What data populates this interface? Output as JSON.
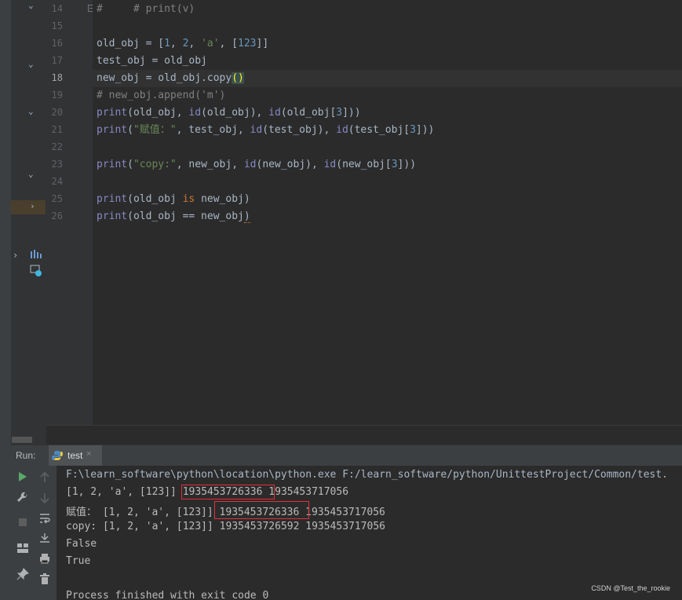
{
  "editor": {
    "lines": [
      {
        "num": "14"
      },
      {
        "num": "15"
      },
      {
        "num": "16"
      },
      {
        "num": "17"
      },
      {
        "num": "18"
      },
      {
        "num": "19"
      },
      {
        "num": "20"
      },
      {
        "num": "21"
      },
      {
        "num": "22"
      },
      {
        "num": "23"
      },
      {
        "num": "24"
      },
      {
        "num": "25"
      },
      {
        "num": "26"
      }
    ],
    "code": {
      "l14": "#     # print(v)",
      "l16_a": "old_obj = [",
      "l16_n1": "1",
      "l16_c1": ", ",
      "l16_n2": "2",
      "l16_c2": ", ",
      "l16_s": "'a'",
      "l16_c3": ", [",
      "l16_n3": "123",
      "l16_e": "]]",
      "l17": "test_obj = old_obj",
      "l18_a": "new_obj = old_obj.copy",
      "l18_p": "()",
      "l19": "# new_obj.append('m')",
      "l20_p": "print",
      "l20_a": "(old_obj, ",
      "l20_id1": "id",
      "l20_b": "(old_obj), ",
      "l20_id2": "id",
      "l20_c": "(old_obj[",
      "l20_n": "3",
      "l20_e": "]))",
      "l21_p": "print",
      "l21_a": "(",
      "l21_s": "\"赋值：\"",
      "l21_b": ", test_obj, ",
      "l21_id1": "id",
      "l21_c": "(test_obj), ",
      "l21_id2": "id",
      "l21_d": "(test_obj[",
      "l21_n": "3",
      "l21_e": "]))",
      "l23_p": "print",
      "l23_a": "(",
      "l23_s": "\"copy:\"",
      "l23_b": ", new_obj, ",
      "l23_id1": "id",
      "l23_c": "(new_obj), ",
      "l23_id2": "id",
      "l23_d": "(new_obj[",
      "l23_n": "3",
      "l23_e": "]))",
      "l25_p": "print",
      "l25_a": "(old_obj ",
      "l25_kw": "is",
      "l25_b": " new_obj)",
      "l26_p": "print",
      "l26_a": "(old_obj == new_obj",
      "l26_e": ")"
    }
  },
  "run": {
    "label": "Run:",
    "tab_label": "test",
    "close": "×"
  },
  "console": {
    "line1": "F:\\learn_software\\python\\location\\python.exe F:/learn_software/python/UnittestProject/Common/test.",
    "line2_a": "[1, 2, 'a', [123]] ",
    "line2_b": "1935453726336",
    "line2_c": " 1935453717056",
    "line3_a": "赋值： [1, 2, 'a', [123]] ",
    "line3_b": "1935453726336",
    "line3_c": " 1935453717056",
    "line4": "copy: [1, 2, 'a', [123]] 1935453726592 1935453717056",
    "line5": "False",
    "line6": "True",
    "line7": "Process finished with exit code 0"
  },
  "watermark": "CSDN @Test_the_rookie",
  "icons": [
    "play-icon",
    "wrench-icon",
    "stop-icon",
    "layout-icon",
    "pin-icon",
    "up-arrow-icon",
    "down-arrow-icon",
    "wrap-icon",
    "scroll-end-icon",
    "print-icon",
    "trash-icon",
    "python-icon",
    "chart-icon",
    "image-icon"
  ],
  "colors": {
    "keyword": "#cc7832",
    "builtin": "#8888c6",
    "number": "#6897bb",
    "string": "#6a8759",
    "comment": "#808080",
    "highlight_box": "#e0313c"
  }
}
